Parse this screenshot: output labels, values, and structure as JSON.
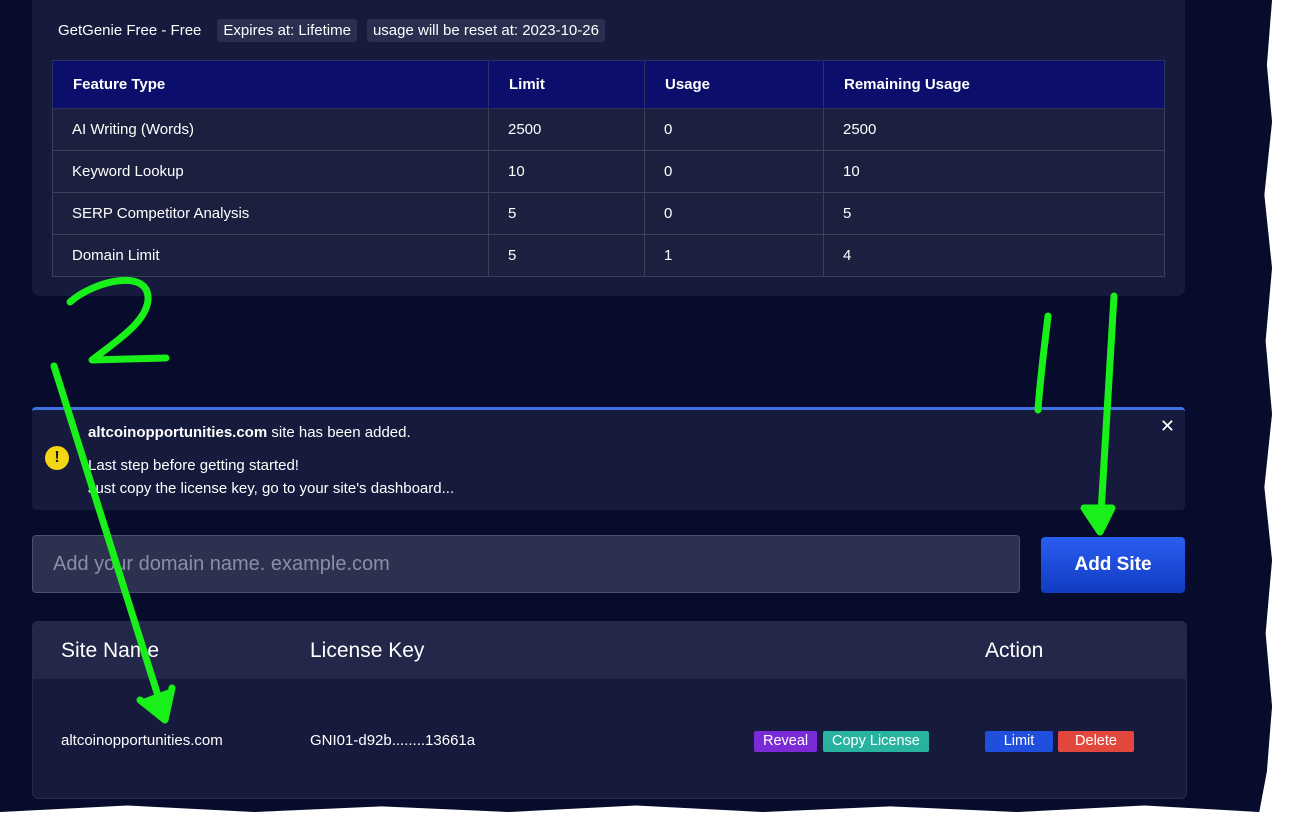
{
  "plan": {
    "name": "GetGenie Free - Free",
    "expires": "Expires at: Lifetime",
    "reset": "usage will be reset at: 2023-10-26"
  },
  "usage_table": {
    "headers": [
      "Feature Type",
      "Limit",
      "Usage",
      "Remaining Usage"
    ],
    "rows": [
      [
        "AI Writing (Words)",
        "2500",
        "0",
        "2500"
      ],
      [
        "Keyword Lookup",
        "10",
        "0",
        "10"
      ],
      [
        "SERP Competitor Analysis",
        "5",
        "0",
        "5"
      ],
      [
        "Domain Limit",
        "5",
        "1",
        "4"
      ]
    ]
  },
  "notice": {
    "site": "altcoinopportunities.com",
    "added_text": " site has been added.",
    "line2": "Last step before getting started!",
    "line3": "Just copy the license key, go to your site's dashboard...",
    "close": "✕"
  },
  "add_site": {
    "placeholder": "Add your domain name. example.com",
    "button": "Add Site"
  },
  "sites_table": {
    "headers": {
      "site_name": "Site Name",
      "license_key": "License Key",
      "action": "Action"
    },
    "row": {
      "site_name": "altcoinopportunities.com",
      "license_key": "GNI01-d92b........13661a",
      "reveal": "Reveal",
      "copy_license": "Copy License",
      "limit": "Limit",
      "delete": "Delete"
    }
  },
  "annotations": {
    "step1": "1",
    "step2": "2",
    "color": "#19f019"
  },
  "colors": {
    "background": "#070b2c",
    "card": "#161b3d",
    "table_header": "#0b0f6b",
    "accent_blue": "#1f4fdc",
    "reveal": "#7a2ad6",
    "copy_license": "#27b3a0",
    "delete": "#e2473d",
    "warning": "#f3d713"
  }
}
